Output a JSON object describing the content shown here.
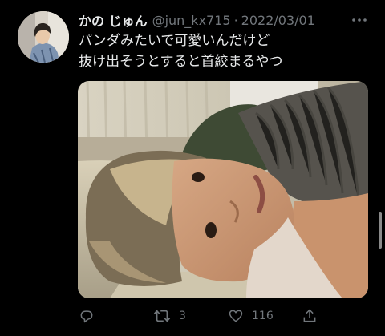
{
  "tweet": {
    "author_name": "かの じゅん",
    "handle": "@jun_kx715",
    "separator": "·",
    "date": "2022/03/01",
    "text_lines": [
      "パンダみたいで可愛いんだけど",
      "抜け出そうとすると首絞まるやつ"
    ]
  },
  "actions": {
    "reply_icon": "reply-icon",
    "retweet_icon": "retweet-icon",
    "retweet_count": "3",
    "like_icon": "like-icon",
    "like_count": "116",
    "share_icon": "share-icon"
  },
  "colors": {
    "background": "#000000",
    "text": "#e7e9ea",
    "secondary": "#71767b"
  }
}
